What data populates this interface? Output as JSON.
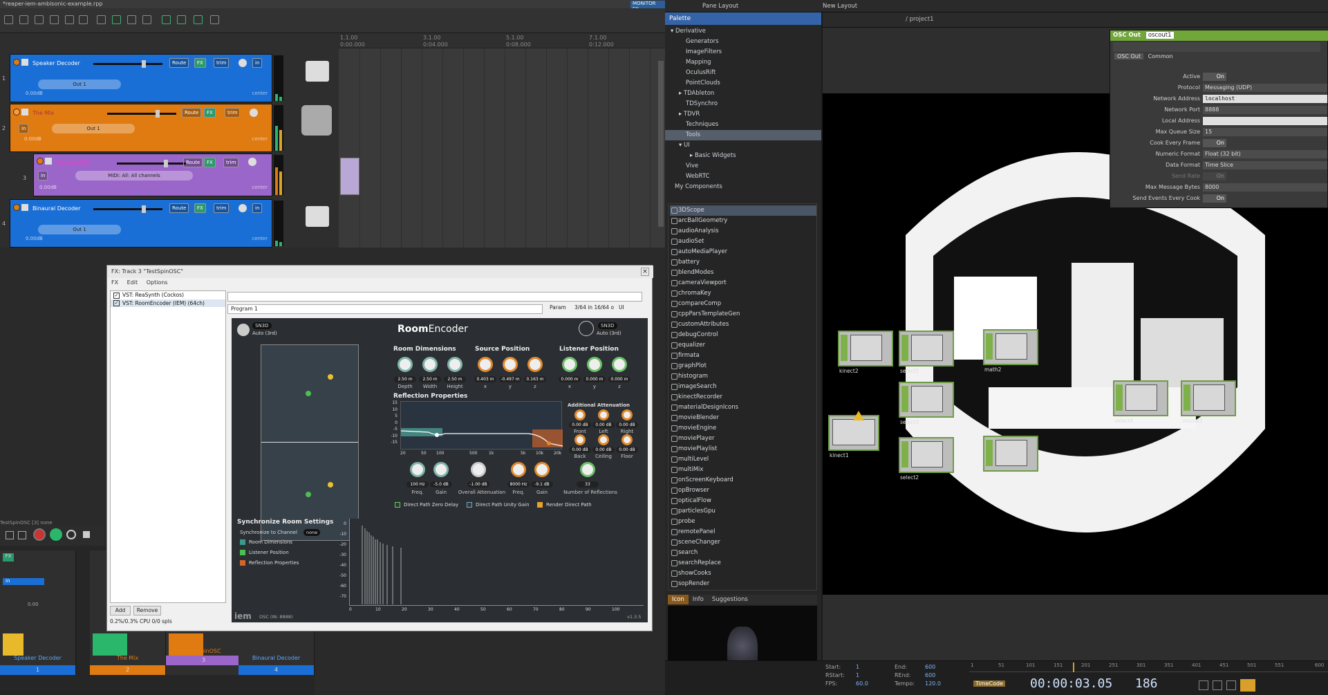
{
  "reaper": {
    "window_title": "*reaper-iem-ambisonic-example.rpp",
    "monitor_fx": "MONITOR FX",
    "ruler": [
      "1.1.00",
      "3.1.00",
      "5.1.00",
      "7.1.00"
    ],
    "ruler_sub": [
      "0:00.000",
      "0:04.000",
      "0:08.000",
      "0:12.000"
    ],
    "tracks": [
      {
        "num": "1",
        "name": "Speaker Decoder",
        "io": "Out 1",
        "db": "0.00dB",
        "pan": "center",
        "color": "#1a6fd6"
      },
      {
        "num": "2",
        "name": "The Mix",
        "io": "Out 1",
        "db": "0.00dB",
        "pan": "center",
        "color": "#e07b12"
      },
      {
        "num": "3",
        "name": "TestSpinOSC",
        "io": "MIDI: All: All channels",
        "db": "0.00dB",
        "pan": "center",
        "color": "#9b66c9"
      },
      {
        "num": "4",
        "name": "Binaural Decoder",
        "io": "Out 1",
        "db": "0.00dB",
        "pan": "center",
        "color": "#1a6fd6"
      }
    ],
    "track_btn_route": "Route",
    "track_btn_fx": "FX",
    "track_btn_trim": "trim",
    "track_btn_in": "in",
    "mixer_label": "TestSpinOSC [3] none",
    "mixer": [
      {
        "name": "Speaker Decoder",
        "num": "1",
        "color": "#1a6fd6"
      },
      {
        "name": "The Mix",
        "num": "2",
        "color": "#e07b12"
      },
      {
        "name": "TestSpinOSC",
        "num": "3",
        "color": "#9b66c9"
      },
      {
        "name": "Binaural Decoder",
        "num": "4",
        "color": "#1a6fd6"
      }
    ],
    "mixer_db": "0.00",
    "mixer_fx": "FX",
    "mixer_in": "in",
    "mixer_route": "Route"
  },
  "fx": {
    "title": "FX: Track 3 \"TestSpinOSC\"",
    "menu": [
      "FX",
      "Edit",
      "Options"
    ],
    "list": [
      "VST: ReaSynth (Cockos)",
      "VST: RoomEncoder (IEM) (64ch)"
    ],
    "add": "Add",
    "remove": "Remove",
    "cpu": "0.2%/0.3% CPU 0/0 spls",
    "preset": "Program 1",
    "param": "Param",
    "io_count": "3/64 in 16/64 o",
    "ui": "UI"
  },
  "plugin": {
    "name_bold": "Room",
    "name_rest": "Encoder",
    "left_norm": "SN3D",
    "left_order": "Auto (3rd)",
    "right_norm": "SN3D",
    "right_order": "Auto (3rd)",
    "room_dims_title": "Room Dimensions",
    "room_dims": [
      {
        "v": "2.50 m",
        "l": "Depth"
      },
      {
        "v": "2.50 m",
        "l": "Width"
      },
      {
        "v": "2.50 m",
        "l": "Height"
      }
    ],
    "source_title": "Source Position",
    "source": [
      {
        "v": "0.403 m",
        "l": "x"
      },
      {
        "v": "-0.497 m",
        "l": "y"
      },
      {
        "v": "0.163 m",
        "l": "z"
      }
    ],
    "listener_title": "Listener Position",
    "listener": [
      {
        "v": "0.000 m",
        "l": "x"
      },
      {
        "v": "0.000 m",
        "l": "y"
      },
      {
        "v": "0.000 m",
        "l": "z"
      }
    ],
    "refl_title": "Reflection Properties",
    "addl_title": "Additional Attenuation",
    "addl": [
      {
        "v": "0.00 dB",
        "l": "Front"
      },
      {
        "v": "0.00 dB",
        "l": "Left"
      },
      {
        "v": "0.00 dB",
        "l": "Right"
      },
      {
        "v": "0.00 dB",
        "l": "Back"
      },
      {
        "v": "0.00 dB",
        "l": "Ceiling"
      },
      {
        "v": "0.00 dB",
        "l": "Floor"
      }
    ],
    "eq_y": [
      "15",
      "10",
      "5",
      "0",
      "-5",
      "-10",
      "-15"
    ],
    "eq_x": [
      "20",
      "50",
      "100",
      "500",
      "1k",
      "5k",
      "10k",
      "20k"
    ],
    "lower_knobs": [
      {
        "v": "100 Hz",
        "l": "Freq."
      },
      {
        "v": "-5.0 dB",
        "l": "Gain"
      },
      {
        "v": "-1.00 dB",
        "l": "Overall Attenuation"
      },
      {
        "v": "8000 Hz",
        "l": "Freq."
      },
      {
        "v": "-9.1 dB",
        "l": "Gain"
      },
      {
        "v": "33",
        "l": "Number of Reflections"
      }
    ],
    "direct": [
      "Direct Path Zero Delay",
      "Direct Path Unity Gain",
      "Render Direct Path"
    ],
    "sync_title": "Synchronize Room Settings",
    "sync_channel_label": "Synchronize to Channel",
    "sync_channel_value": "none",
    "sync_items": [
      "Room Dimensions",
      "Listener Position",
      "Reflection Properties"
    ],
    "ir_y": [
      "0",
      "-10",
      "-20",
      "-30",
      "-40",
      "-50",
      "-60",
      "-70"
    ],
    "ir_x": [
      "0",
      "10",
      "20",
      "30",
      "40",
      "50",
      "60",
      "70",
      "80",
      "90",
      "100"
    ],
    "brand": "iem",
    "osc": "OSC (IN: 8888)",
    "version": "v1.3.5"
  },
  "td": {
    "pane_layout": "Pane Layout",
    "new_layout": "New Layout",
    "path": "/ project1",
    "palette_title": "Palette",
    "palette_tree": [
      {
        "t": "▾ Derivative",
        "d": 0
      },
      {
        "t": "Generators",
        "d": 2
      },
      {
        "t": "ImageFilters",
        "d": 2
      },
      {
        "t": "Mapping",
        "d": 2
      },
      {
        "t": "OculusRift",
        "d": 2
      },
      {
        "t": "PointClouds",
        "d": 2
      },
      {
        "t": "▸ TDAbleton",
        "d": 1
      },
      {
        "t": "TDSynchro",
        "d": 2
      },
      {
        "t": "▸ TDVR",
        "d": 1
      },
      {
        "t": "Techniques",
        "d": 2
      },
      {
        "t": "Tools",
        "d": 2,
        "sel": true
      },
      {
        "t": "▾ UI",
        "d": 1
      },
      {
        "t": "▸ Basic Widgets",
        "d": 3
      },
      {
        "t": "Vive",
        "d": 2
      },
      {
        "t": "WebRTC",
        "d": 2
      },
      {
        "t": "My Components",
        "d": 1
      }
    ],
    "components": [
      "3DScope",
      "arcBallGeometry",
      "audioAnalysis",
      "audioSet",
      "autoMediaPlayer",
      "battery",
      "blendModes",
      "cameraViewport",
      "chromaKey",
      "compareComp",
      "cppParsTemplateGen",
      "customAttributes",
      "debugControl",
      "equalizer",
      "firmata",
      "graphPlot",
      "histogram",
      "imageSearch",
      "kinectRecorder",
      "materialDesignIcons",
      "movieBlender",
      "movieEngine",
      "moviePlayer",
      "moviePlaylist",
      "multiLevel",
      "multiMix",
      "onScreenKeyboard",
      "opBrowser",
      "opticalFlow",
      "particlesGpu",
      "probe",
      "remotePanel",
      "sceneChanger",
      "search",
      "searchReplace",
      "showCooks",
      "sopRender"
    ],
    "pal_tabs": [
      "Icon",
      "Info",
      "Suggestions"
    ],
    "nodes": [
      "kinect2",
      "select1",
      "math2",
      "select3",
      "select2",
      "select4",
      "oscout1",
      "kinect1",
      "null1"
    ],
    "osc": {
      "op_type": "OSC Out",
      "op_name": "oscout1",
      "tabs": [
        "OSC Out",
        "Common"
      ],
      "params": [
        {
          "k": "Active",
          "type": "toggle",
          "v": "On"
        },
        {
          "k": "Protocol",
          "type": "menu",
          "v": "Messaging (UDP)"
        },
        {
          "k": "Network Address",
          "type": "text",
          "v": "localhost"
        },
        {
          "k": "Network Port",
          "type": "num",
          "v": "8888"
        },
        {
          "k": "Local Address",
          "type": "text",
          "v": ""
        },
        {
          "k": "Max Queue Size",
          "type": "num",
          "v": "15"
        },
        {
          "k": "Cook Every Frame",
          "type": "toggle",
          "v": "On"
        },
        {
          "k": "Numeric Format",
          "type": "menu",
          "v": "Float (32 bit)"
        },
        {
          "k": "Data Format",
          "type": "menu",
          "v": "Time Slice"
        },
        {
          "k": "Send Rate",
          "type": "toggle",
          "v": "On"
        },
        {
          "k": "Max Message Bytes",
          "type": "num",
          "v": "8000"
        },
        {
          "k": "Send Events Every Cook",
          "type": "toggle",
          "v": "On"
        }
      ]
    },
    "timeline": {
      "start_l": "Start:",
      "start": "1",
      "end_l": "End:",
      "end": "600",
      "rstart_l": "RStart:",
      "rstart": "1",
      "rend_l": "REnd:",
      "rend": "600",
      "fps_l": "FPS:",
      "fps": "60.0",
      "tempo_l": "Tempo:",
      "tempo": "120.0",
      "ticks": [
        "1",
        "51",
        "101",
        "151",
        "201",
        "251",
        "301",
        "351",
        "401",
        "451",
        "501",
        "551",
        "600"
      ],
      "timecode_label": "TimeCode",
      "timecode": "00:00:03.05",
      "frame": "186"
    }
  }
}
